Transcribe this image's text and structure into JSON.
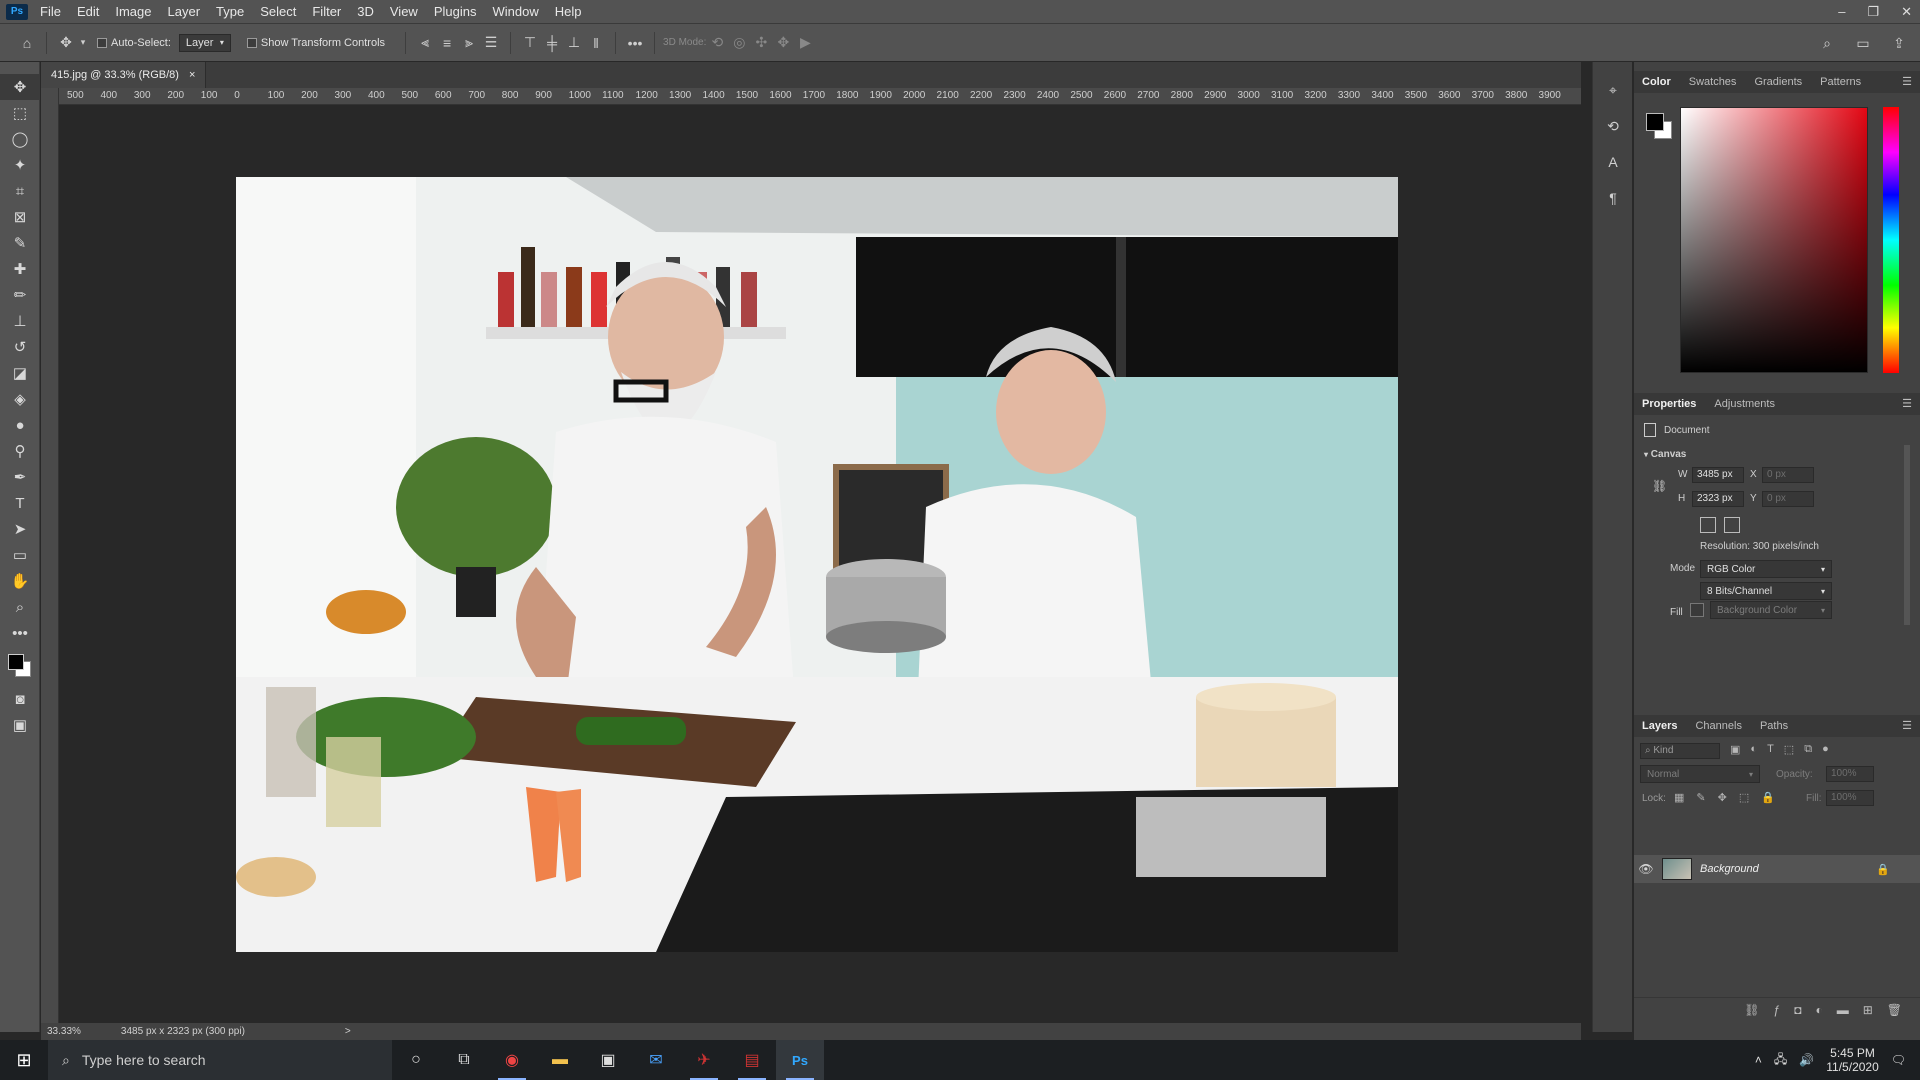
{
  "menubar": {
    "app_logo": "Ps",
    "items": [
      "File",
      "Edit",
      "Image",
      "Layer",
      "Type",
      "Select",
      "Filter",
      "3D",
      "View",
      "Plugins",
      "Window",
      "Help"
    ],
    "window_controls": [
      "–",
      "❐",
      "✕"
    ]
  },
  "options": {
    "auto_select_label": "Auto-Select:",
    "layer_select": "Layer",
    "transform_label": "Show Transform Controls",
    "mode_3d_label": "3D Mode:"
  },
  "document": {
    "tab_title": "415.jpg @ 33.3% (RGB/8)",
    "ruler_labels": [
      "500",
      "400",
      "300",
      "200",
      "100",
      "0",
      "100",
      "200",
      "300",
      "400",
      "500",
      "600",
      "700",
      "800",
      "900",
      "1000",
      "1100",
      "1200",
      "1300",
      "1400",
      "1500",
      "1600",
      "1700",
      "1800",
      "1900",
      "2000",
      "2100",
      "2200",
      "2300",
      "2400",
      "2500",
      "2600",
      "2700",
      "2800",
      "2900",
      "3000",
      "3100",
      "3200",
      "3300",
      "3400",
      "3500",
      "3600",
      "3700",
      "3800",
      "3900"
    ]
  },
  "status": {
    "zoom": "33.33%",
    "doc_info": "3485 px x 2323 px (300 ppi)",
    "arrow": ">"
  },
  "color_panel": {
    "tabs": [
      "Color",
      "Swatches",
      "Gradients",
      "Patterns"
    ],
    "base_hue": "#e30613"
  },
  "properties": {
    "tabs": [
      "Properties",
      "Adjustments"
    ],
    "doc_label": "Document",
    "section": "Canvas",
    "w_label": "W",
    "w_value": "3485 px",
    "h_label": "H",
    "h_value": "2323 px",
    "x_label": "X",
    "x_value": "0 px",
    "y_label": "Y",
    "y_value": "0 px",
    "resolution": "Resolution: 300 pixels/inch",
    "mode_label": "Mode",
    "mode_value": "RGB Color",
    "bits_value": "8 Bits/Channel",
    "fill_label": "Fill",
    "fill_value": "Background Color"
  },
  "layers": {
    "tabs": [
      "Layers",
      "Channels",
      "Paths"
    ],
    "kind_placeholder": "Kind",
    "blend_mode": "Normal",
    "opacity_label": "Opacity:",
    "opacity_value": "100%",
    "lock_label": "Lock:",
    "fill_label": "Fill:",
    "fill_value": "100%",
    "layer_name": "Background"
  },
  "taskbar": {
    "search_placeholder": "Type here to search",
    "time": "5:45 PM",
    "date": "11/5/2020"
  }
}
